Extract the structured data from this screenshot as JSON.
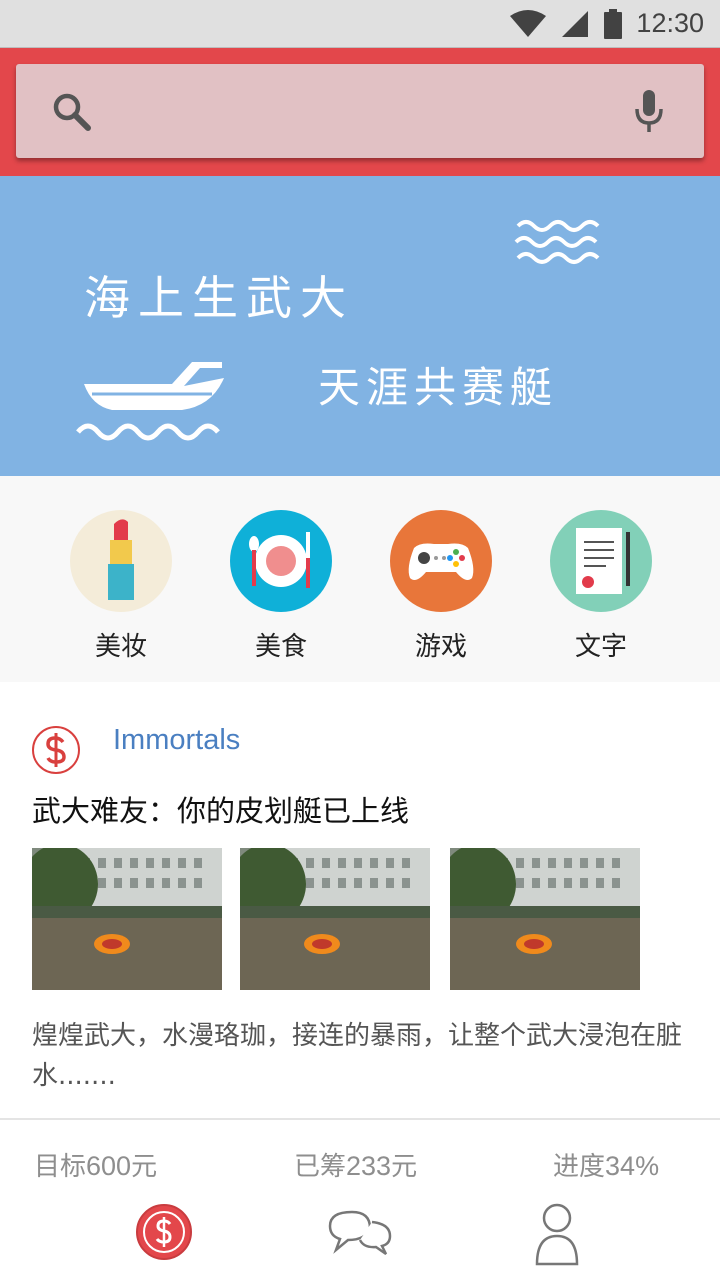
{
  "status_bar": {
    "time": "12:30"
  },
  "search": {
    "placeholder": ""
  },
  "banner": {
    "line1": "海上生武大",
    "line2": "天涯共赛艇"
  },
  "categories": [
    {
      "label": "美妆",
      "icon": "lipstick-icon",
      "color": "#f4ecd9"
    },
    {
      "label": "美食",
      "icon": "plate-icon",
      "color": "#0fb0d8"
    },
    {
      "label": "游戏",
      "icon": "gamepad-icon",
      "color": "#e8763a"
    },
    {
      "label": "文字",
      "icon": "certificate-icon",
      "color": "#82d0b8"
    }
  ],
  "post": {
    "author": "Immortals",
    "title": "武大难友：你的皮划艇已上线",
    "description": "煌煌武大，水漫珞珈，接连的暴雨，让整个武大浸泡在脏水......."
  },
  "stats": {
    "goal_label": "目标",
    "goal_value": "600",
    "goal_unit": "元",
    "raised_label": "已筹",
    "raised_value": "233",
    "raised_unit": "元",
    "progress_label": "进度",
    "progress_value": "34",
    "progress_unit": "%"
  },
  "bottom_nav": [
    {
      "icon": "dollar-icon",
      "active": true
    },
    {
      "icon": "chat-icon",
      "active": false
    },
    {
      "icon": "person-icon",
      "active": false
    }
  ],
  "colors": {
    "accent": "#e3474b",
    "banner": "#81b3e3",
    "link": "#4a7fc1"
  }
}
